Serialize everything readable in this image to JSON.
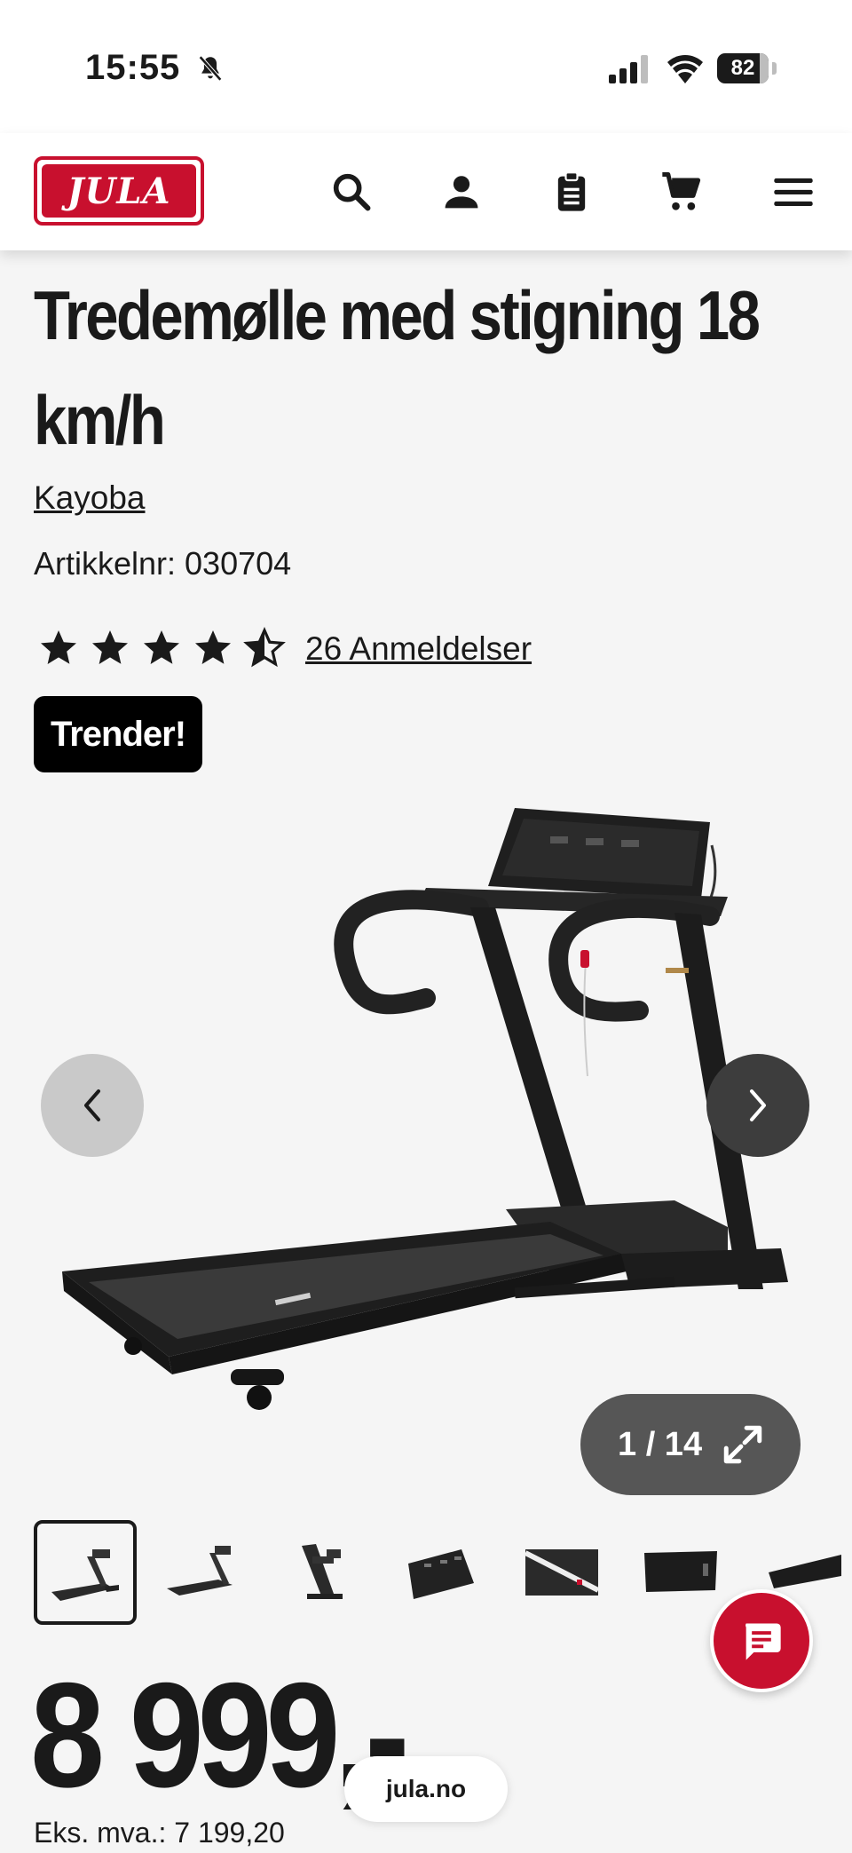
{
  "status_bar": {
    "time": "15:55",
    "battery": "82",
    "battery_level": 0.82
  },
  "header": {
    "logo_text": "JULA",
    "icons": [
      "search-icon",
      "account-icon",
      "clipboard-list-icon",
      "cart-icon",
      "menu-icon"
    ]
  },
  "product": {
    "title": "Tredemølle med stigning 18 km/h",
    "brand": "Kayoba",
    "article_number": "Artikkelnr: 030704",
    "rating": 4.5,
    "reviews_link": "26 Anmeldelser",
    "badge": "Trender!",
    "price": "8 999,-",
    "price_ex_vat": "Eks. mva.: 7 199,20"
  },
  "gallery": {
    "counter": "1 / 14",
    "thumbnail_count_visible": 7
  },
  "browser": {
    "url": "jula.no"
  },
  "colors": {
    "brand_red": "#c8102e",
    "text": "#1a1a1a",
    "background": "#f5f5f5"
  }
}
